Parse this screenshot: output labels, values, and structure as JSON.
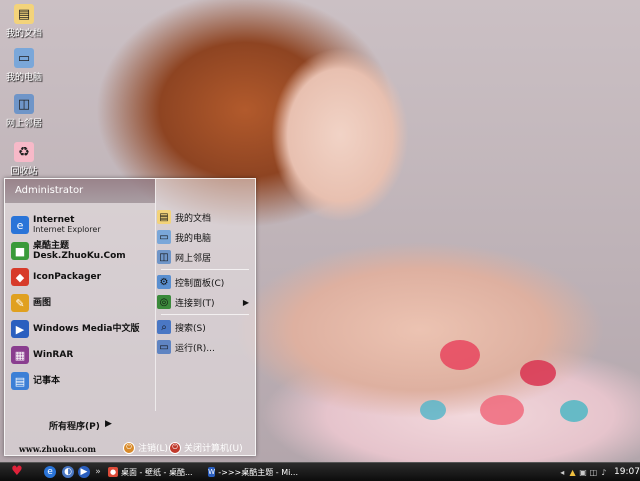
{
  "desktop": {
    "icons": [
      {
        "label": "我的文档",
        "icon": "my-documents-icon",
        "color": "#f3d37a"
      },
      {
        "label": "我的电脑",
        "icon": "my-computer-icon",
        "color": "#7aa7d9"
      },
      {
        "label": "网上邻居",
        "icon": "network-icon",
        "color": "#6f95c8"
      },
      {
        "label": "回收站",
        "icon": "recycle-bin-icon",
        "color": "#f7b9c8"
      }
    ]
  },
  "start_menu": {
    "user": "Administrator",
    "programs": [
      {
        "title": "Internet",
        "subtitle": "Internet Explorer",
        "icon": "ie-icon",
        "color": "#2a74d8"
      },
      {
        "title": "桌酷主题Desk.ZhuoKu.Com",
        "subtitle": "",
        "icon": "zhuoku-icon",
        "color": "#3a9a3a"
      },
      {
        "title": "IconPackager",
        "subtitle": "",
        "icon": "iconpackager-icon",
        "color": "#d73b2a"
      },
      {
        "title": "画图",
        "subtitle": "",
        "icon": "paint-icon",
        "color": "#e0a020"
      },
      {
        "title": "Windows Media中文版",
        "subtitle": "",
        "icon": "media-player-icon",
        "color": "#2b5fbf"
      },
      {
        "title": "WinRAR",
        "subtitle": "",
        "icon": "winrar-icon",
        "color": "#8a3d8f"
      },
      {
        "title": "记事本",
        "subtitle": "",
        "icon": "notepad-icon",
        "color": "#3c7fd6"
      }
    ],
    "places": [
      {
        "label": "我的文档",
        "icon": "my-documents-icon",
        "color": "#f3d37a",
        "arrow": false
      },
      {
        "label": "我的电脑",
        "icon": "my-computer-icon",
        "color": "#7aa7d9",
        "arrow": false
      },
      {
        "label": "网上邻居",
        "icon": "network-icon",
        "color": "#6f95c8",
        "arrow": false
      },
      {
        "label": "控制面板(C)",
        "icon": "control-panel-icon",
        "color": "#5a8fd0",
        "arrow": false
      },
      {
        "label": "连接到(T)",
        "icon": "connect-icon",
        "color": "#3b8a3b",
        "arrow": true
      },
      {
        "label": "搜索(S)",
        "icon": "search-icon",
        "color": "#4a77c4",
        "arrow": false
      },
      {
        "label": "运行(R)...",
        "icon": "run-icon",
        "color": "#5f84c2",
        "arrow": false
      }
    ],
    "all_programs": "所有程序(P)",
    "website": "www.zhuoku.com",
    "logoff": "注销(L)",
    "shutdown": "关闭计算机(U)"
  },
  "taskbar": {
    "tasks": [
      {
        "label": "桌面 - 壁纸 - 桌酷...",
        "icon": "chrome-icon",
        "color": "#dd4b39"
      },
      {
        "label": "->>>桌酷主题 - Mi...",
        "icon": "word-icon",
        "color": "#2b5fbf"
      }
    ],
    "clock": "19:07"
  },
  "colors": {
    "accent": "#e0223a",
    "taskbar": "#111111"
  }
}
